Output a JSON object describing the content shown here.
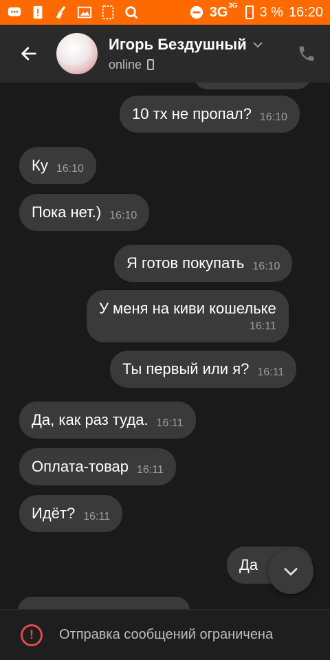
{
  "status_bar": {
    "network": "3G",
    "network_sup": "3G",
    "battery": "3 %",
    "time": "16:20",
    "icons": [
      "chat-icon",
      "alert-icon",
      "broom-icon",
      "image-icon",
      "sim-icon",
      "search-icon",
      "dnd-icon"
    ]
  },
  "header": {
    "name": "Игорь Бездушный",
    "status": "online"
  },
  "messages": [
    {
      "text": "10 тх не пропал?",
      "time": "16:10"
    },
    {
      "text": "Ку",
      "time": "16:10"
    },
    {
      "text": "Пока нет.)",
      "time": "16:10"
    },
    {
      "text": "Я готов покупать",
      "time": "16:10"
    },
    {
      "text": "У меня на киви кошельке",
      "time": "16:11"
    },
    {
      "text": "Ты первый или я?",
      "time": "16:11"
    },
    {
      "text": "Да, как раз туда.",
      "time": "16:11"
    },
    {
      "text": "Оплата-товар",
      "time": "16:11"
    },
    {
      "text": "Идёт?",
      "time": "16:11"
    },
    {
      "text": "Да",
      "time": ""
    }
  ],
  "bottom_bar": {
    "text": "Отправка сообщений ограничена"
  },
  "colors": {
    "status_bar": "#ff6a00",
    "header": "#2a2a2a",
    "background": "#1a1a1a",
    "bubble": "#3a3a3a",
    "warning": "#e04b4b"
  }
}
